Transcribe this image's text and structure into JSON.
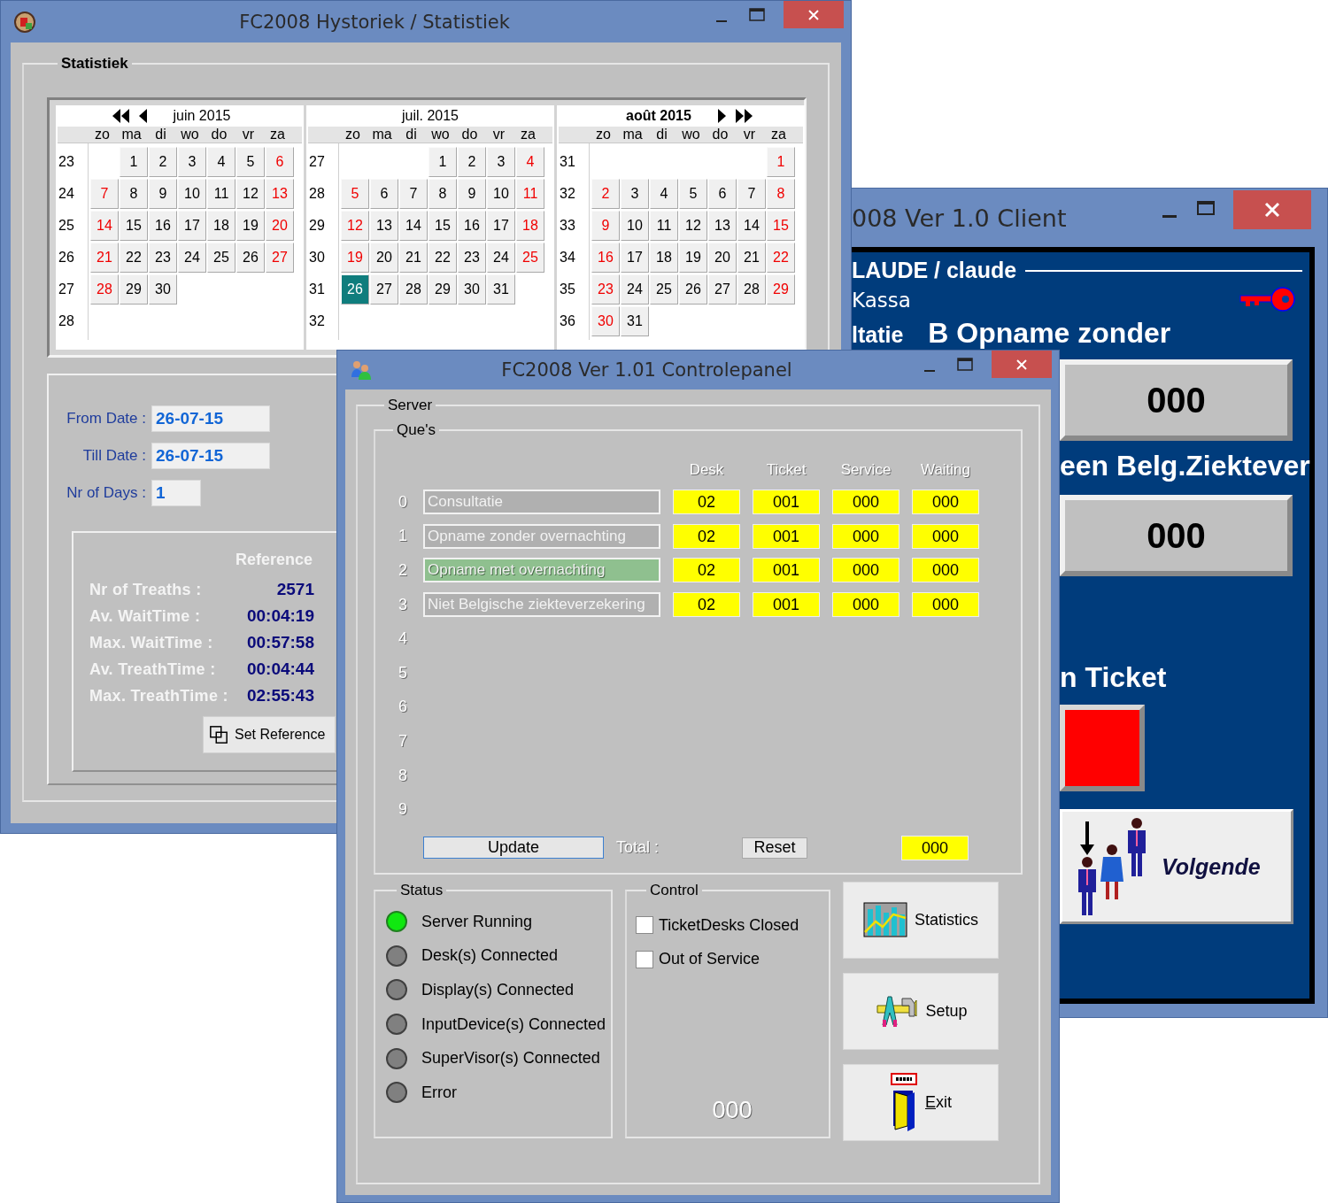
{
  "stats_window": {
    "title": "FC2008 Hystoriek / Statistiek",
    "group": "Statistiek",
    "months": [
      {
        "title": "juin 2015",
        "focused": false,
        "prev_buttons": true,
        "next_buttons": false,
        "weekdays": [
          "zo",
          "ma",
          "di",
          "wo",
          "do",
          "vr",
          "za"
        ],
        "weeks": [
          {
            "week": "23",
            "days": [
              {
                "kind": "blank"
              },
              {
                "kind": "day",
                "n": "1",
                "selected": false
              },
              {
                "kind": "day",
                "n": "2",
                "selected": false
              },
              {
                "kind": "day",
                "n": "3",
                "selected": false
              },
              {
                "kind": "day",
                "n": "4",
                "selected": false
              },
              {
                "kind": "day",
                "n": "5",
                "selected": false
              },
              {
                "kind": "day",
                "n": "6",
                "selected": false
              }
            ]
          },
          {
            "week": "24",
            "days": [
              {
                "kind": "day",
                "n": "7",
                "selected": false
              },
              {
                "kind": "day",
                "n": "8",
                "selected": false
              },
              {
                "kind": "day",
                "n": "9",
                "selected": false
              },
              {
                "kind": "day",
                "n": "10",
                "selected": false
              },
              {
                "kind": "day",
                "n": "11",
                "selected": false
              },
              {
                "kind": "day",
                "n": "12",
                "selected": false
              },
              {
                "kind": "day",
                "n": "13",
                "selected": false
              }
            ]
          },
          {
            "week": "25",
            "days": [
              {
                "kind": "day",
                "n": "14",
                "selected": false
              },
              {
                "kind": "day",
                "n": "15",
                "selected": false
              },
              {
                "kind": "day",
                "n": "16",
                "selected": false
              },
              {
                "kind": "day",
                "n": "17",
                "selected": false
              },
              {
                "kind": "day",
                "n": "18",
                "selected": false
              },
              {
                "kind": "day",
                "n": "19",
                "selected": false
              },
              {
                "kind": "day",
                "n": "20",
                "selected": false
              }
            ]
          },
          {
            "week": "26",
            "days": [
              {
                "kind": "day",
                "n": "21",
                "selected": false
              },
              {
                "kind": "day",
                "n": "22",
                "selected": false
              },
              {
                "kind": "day",
                "n": "23",
                "selected": false
              },
              {
                "kind": "day",
                "n": "24",
                "selected": false
              },
              {
                "kind": "day",
                "n": "25",
                "selected": false
              },
              {
                "kind": "day",
                "n": "26",
                "selected": false
              },
              {
                "kind": "day",
                "n": "27",
                "selected": false
              }
            ]
          },
          {
            "week": "27",
            "days": [
              {
                "kind": "day",
                "n": "28",
                "selected": false
              },
              {
                "kind": "day",
                "n": "29",
                "selected": false
              },
              {
                "kind": "day",
                "n": "30",
                "selected": false
              }
            ]
          },
          {
            "week": "28"
          }
        ]
      },
      {
        "title": "juil. 2015",
        "focused": false,
        "prev_buttons": false,
        "next_buttons": false,
        "weekdays": [
          "zo",
          "ma",
          "di",
          "wo",
          "do",
          "vr",
          "za"
        ],
        "weeks": [
          {
            "week": "27",
            "days": [
              {
                "kind": "blank"
              },
              {
                "kind": "blank"
              },
              {
                "kind": "blank"
              },
              {
                "kind": "day",
                "n": "1",
                "selected": false
              },
              {
                "kind": "day",
                "n": "2",
                "selected": false
              },
              {
                "kind": "day",
                "n": "3",
                "selected": false
              },
              {
                "kind": "day",
                "n": "4",
                "selected": false
              }
            ]
          },
          {
            "week": "28",
            "days": [
              {
                "kind": "day",
                "n": "5",
                "selected": false
              },
              {
                "kind": "day",
                "n": "6",
                "selected": false
              },
              {
                "kind": "day",
                "n": "7",
                "selected": false
              },
              {
                "kind": "day",
                "n": "8",
                "selected": false
              },
              {
                "kind": "day",
                "n": "9",
                "selected": false
              },
              {
                "kind": "day",
                "n": "10",
                "selected": false
              },
              {
                "kind": "day",
                "n": "11",
                "selected": false
              }
            ]
          },
          {
            "week": "29",
            "days": [
              {
                "kind": "day",
                "n": "12",
                "selected": false
              },
              {
                "kind": "day",
                "n": "13",
                "selected": false
              },
              {
                "kind": "day",
                "n": "14",
                "selected": false
              },
              {
                "kind": "day",
                "n": "15",
                "selected": false
              },
              {
                "kind": "day",
                "n": "16",
                "selected": false
              },
              {
                "kind": "day",
                "n": "17",
                "selected": false
              },
              {
                "kind": "day",
                "n": "18",
                "selected": false
              }
            ]
          },
          {
            "week": "30",
            "days": [
              {
                "kind": "day",
                "n": "19",
                "selected": false
              },
              {
                "kind": "day",
                "n": "20",
                "selected": false
              },
              {
                "kind": "day",
                "n": "21",
                "selected": false
              },
              {
                "kind": "day",
                "n": "22",
                "selected": false
              },
              {
                "kind": "day",
                "n": "23",
                "selected": false
              },
              {
                "kind": "day",
                "n": "24",
                "selected": false
              },
              {
                "kind": "day",
                "n": "25",
                "selected": false
              }
            ]
          },
          {
            "week": "31",
            "days": [
              {
                "kind": "day",
                "n": "26",
                "selected": true
              },
              {
                "kind": "day",
                "n": "27",
                "selected": false
              },
              {
                "kind": "day",
                "n": "28",
                "selected": false
              },
              {
                "kind": "day",
                "n": "29",
                "selected": false
              },
              {
                "kind": "day",
                "n": "30",
                "selected": false
              },
              {
                "kind": "day",
                "n": "31",
                "selected": false
              }
            ]
          },
          {
            "week": "32"
          }
        ]
      },
      {
        "title": "août 2015",
        "focused": true,
        "prev_buttons": false,
        "next_buttons": true,
        "weekdays": [
          "zo",
          "ma",
          "di",
          "wo",
          "do",
          "vr",
          "za"
        ],
        "weeks": [
          {
            "week": "31",
            "days": [
              {
                "kind": "blank"
              },
              {
                "kind": "blank"
              },
              {
                "kind": "blank"
              },
              {
                "kind": "blank"
              },
              {
                "kind": "blank"
              },
              {
                "kind": "blank"
              },
              {
                "kind": "day",
                "n": "1",
                "selected": false
              }
            ]
          },
          {
            "week": "32",
            "days": [
              {
                "kind": "day",
                "n": "2",
                "selected": false
              },
              {
                "kind": "day",
                "n": "3",
                "selected": false
              },
              {
                "kind": "day",
                "n": "4",
                "selected": false
              },
              {
                "kind": "day",
                "n": "5",
                "selected": false
              },
              {
                "kind": "day",
                "n": "6",
                "selected": false
              },
              {
                "kind": "day",
                "n": "7",
                "selected": false
              },
              {
                "kind": "day",
                "n": "8",
                "selected": false
              }
            ]
          },
          {
            "week": "33",
            "days": [
              {
                "kind": "day",
                "n": "9",
                "selected": false
              },
              {
                "kind": "day",
                "n": "10",
                "selected": false
              },
              {
                "kind": "day",
                "n": "11",
                "selected": false
              },
              {
                "kind": "day",
                "n": "12",
                "selected": false
              },
              {
                "kind": "day",
                "n": "13",
                "selected": false
              },
              {
                "kind": "day",
                "n": "14",
                "selected": false
              },
              {
                "kind": "day",
                "n": "15",
                "selected": false
              }
            ]
          },
          {
            "week": "34",
            "days": [
              {
                "kind": "day",
                "n": "16",
                "selected": false
              },
              {
                "kind": "day",
                "n": "17",
                "selected": false
              },
              {
                "kind": "day",
                "n": "18",
                "selected": false
              },
              {
                "kind": "day",
                "n": "19",
                "selected": false
              },
              {
                "kind": "day",
                "n": "20",
                "selected": false
              },
              {
                "kind": "day",
                "n": "21",
                "selected": false
              },
              {
                "kind": "day",
                "n": "22",
                "selected": false
              }
            ]
          },
          {
            "week": "35",
            "days": [
              {
                "kind": "day",
                "n": "23",
                "selected": false
              },
              {
                "kind": "day",
                "n": "24",
                "selected": false
              },
              {
                "kind": "day",
                "n": "25",
                "selected": false
              },
              {
                "kind": "day",
                "n": "26",
                "selected": false
              },
              {
                "kind": "day",
                "n": "27",
                "selected": false
              },
              {
                "kind": "day",
                "n": "28",
                "selected": false
              },
              {
                "kind": "day",
                "n": "29",
                "selected": false
              }
            ]
          },
          {
            "week": "36",
            "days": [
              {
                "kind": "day",
                "n": "30",
                "selected": false
              },
              {
                "kind": "day",
                "n": "31",
                "selected": false
              }
            ]
          }
        ]
      }
    ],
    "fields": [
      {
        "label": "From Date :",
        "value": "26-07-15"
      },
      {
        "label": "Till Date :",
        "value": "26-07-15"
      },
      {
        "label": "Nr of Days :",
        "value": "1"
      }
    ],
    "reference": {
      "title": "Reference",
      "rows": [
        {
          "label": "Nr of Treaths :",
          "value": "2571"
        },
        {
          "label": "Av. WaitTime :",
          "value": "00:04:19"
        },
        {
          "label": "Max. WaitTime :",
          "value": "00:57:58"
        },
        {
          "label": "Av. TreathTime :",
          "value": "00:04:44"
        },
        {
          "label": "Max. TreathTime :",
          "value": "02:55:43"
        }
      ]
    },
    "set_reference_button": "Set Reference"
  },
  "client_window": {
    "title": "008 Ver 1.0 Client",
    "user": "LAUDE / claude",
    "desk": "Kassa",
    "queue_left": "ltatie",
    "queue_right": "B Opname zonder",
    "counter_1": "000",
    "queue_2": "een Belg.Ziektever",
    "counter_2": "000",
    "ticket_label": "n Ticket",
    "next_button": "Volgende"
  },
  "control_panel": {
    "title": "FC2008 Ver 1.01 Controlepanel",
    "server_group": "Server",
    "queues_group": "Que's",
    "columns": [
      "Desk",
      "Ticket",
      "Service",
      "Waiting"
    ],
    "queues": [
      {
        "index": "0",
        "name": "Consultatie",
        "highlighted": false,
        "values": [
          "02",
          "001",
          "000",
          "000"
        ]
      },
      {
        "index": "1",
        "name": "Opname zonder overnachting",
        "highlighted": false,
        "values": [
          "02",
          "001",
          "000",
          "000"
        ]
      },
      {
        "index": "2",
        "name": "Opname met overnachting",
        "highlighted": true,
        "values": [
          "02",
          "001",
          "000",
          "000"
        ]
      },
      {
        "index": "3",
        "name": "Niet Belgische ziekteverzekering",
        "highlighted": false,
        "values": [
          "02",
          "001",
          "000",
          "000"
        ]
      },
      {
        "index": "4"
      },
      {
        "index": "5"
      },
      {
        "index": "6"
      },
      {
        "index": "7"
      },
      {
        "index": "8"
      },
      {
        "index": "9"
      }
    ],
    "update_button": "Update",
    "total_label": "Total :",
    "reset_button": "Reset",
    "total": "000",
    "status_group": "Status",
    "status": [
      {
        "label": "Server Running",
        "on": true
      },
      {
        "label": "Desk(s) Connected",
        "on": false
      },
      {
        "label": "Display(s) Connected",
        "on": false
      },
      {
        "label": "InputDevice(s) Connected",
        "on": false
      },
      {
        "label": "SuperVisor(s) Connected",
        "on": false
      },
      {
        "label": "Error",
        "on": false
      }
    ],
    "control_group": "Control",
    "checks": [
      {
        "label": "TicketDesks Closed",
        "checked": false
      },
      {
        "label": "Out of Service",
        "checked": false
      }
    ],
    "control_counter": "000",
    "buttons": [
      {
        "kind": "statistics",
        "label": "Statistics"
      },
      {
        "kind": "setup",
        "label": "Setup"
      },
      {
        "kind": "exit",
        "label": "Exit"
      }
    ]
  }
}
